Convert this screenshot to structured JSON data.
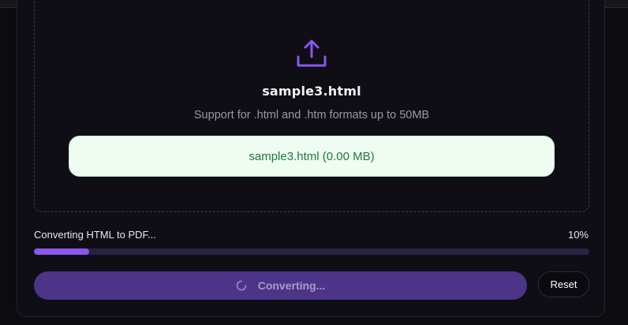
{
  "dropzone": {
    "icon": "upload-icon",
    "file_title": "sample3.html",
    "support_text": "Support for .html and .htm formats up to 50MB",
    "selected_file": "sample3.html (0.00 MB)"
  },
  "progress": {
    "status": "Converting HTML to PDF...",
    "percent_label": "10%",
    "percent_value": 10
  },
  "actions": {
    "convert_label": "Converting...",
    "convert_icon": "spinner-icon",
    "reset_label": "Reset"
  },
  "colors": {
    "accent": "#8a56ee",
    "progress_track": "#2a2245",
    "convert_button_bg": "#4c3488",
    "file_chip_bg": "#effcf2",
    "file_chip_text": "#1e7a3c"
  }
}
